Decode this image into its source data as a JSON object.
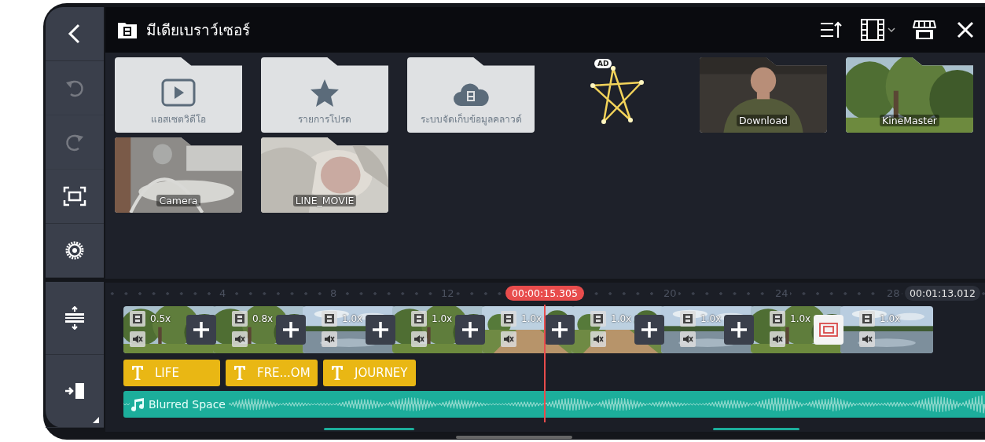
{
  "header": {
    "title": "มีเดียเบราว์เซอร์"
  },
  "rail": {
    "top": [
      {
        "kind": "back",
        "disabled": false
      },
      {
        "kind": "undo",
        "disabled": true
      },
      {
        "kind": "redo",
        "disabled": true
      },
      {
        "kind": "capture",
        "disabled": false
      },
      {
        "kind": "settings",
        "disabled": false
      }
    ],
    "bottom": [
      {
        "kind": "spacing"
      },
      {
        "kind": "jump"
      }
    ]
  },
  "items": [
    {
      "kind": "assets",
      "label": "แอสเซตวิดีโอ"
    },
    {
      "kind": "favorites",
      "label": "รายการโปรด"
    },
    {
      "kind": "cloud",
      "label": "ระบบจัดเก็บข้อมูลคลาวด์"
    },
    {
      "kind": "ad",
      "badge": "AD"
    },
    {
      "kind": "album",
      "label": "Download"
    },
    {
      "kind": "album",
      "label": "KineMaster"
    },
    {
      "kind": "album",
      "label": "Camera"
    },
    {
      "kind": "album",
      "label": "LINE_MOVIE"
    }
  ],
  "timeline": {
    "ticks": [
      "4",
      "8",
      "12",
      "20",
      "24",
      "28"
    ],
    "playhead": "00:00:15.305",
    "duration": "00:01:13.012",
    "clips": [
      {
        "speed": "0.5x",
        "muted": true
      },
      {
        "speed": "0.8x",
        "muted": true
      },
      {
        "speed": "1.0x",
        "muted": true
      },
      {
        "speed": "1.0x",
        "muted": true
      },
      {
        "speed": "1.0x",
        "muted": true
      },
      {
        "speed": "1.0x",
        "muted": true
      },
      {
        "speed": "1.0x",
        "muted": true
      },
      {
        "speed": "1.0x",
        "muted": true
      },
      {
        "speed": "1.0x",
        "muted": true
      }
    ],
    "transitions": [
      {
        "kind": "add"
      },
      {
        "kind": "add"
      },
      {
        "kind": "add"
      },
      {
        "kind": "add"
      },
      {
        "kind": "add"
      },
      {
        "kind": "add"
      },
      {
        "kind": "add"
      },
      {
        "kind": "effect"
      }
    ],
    "text_clips": [
      {
        "label": "LIFE"
      },
      {
        "label": "FRE...OM"
      },
      {
        "label": "JOURNEY"
      }
    ],
    "audio": {
      "label": "Blurred Space"
    }
  }
}
